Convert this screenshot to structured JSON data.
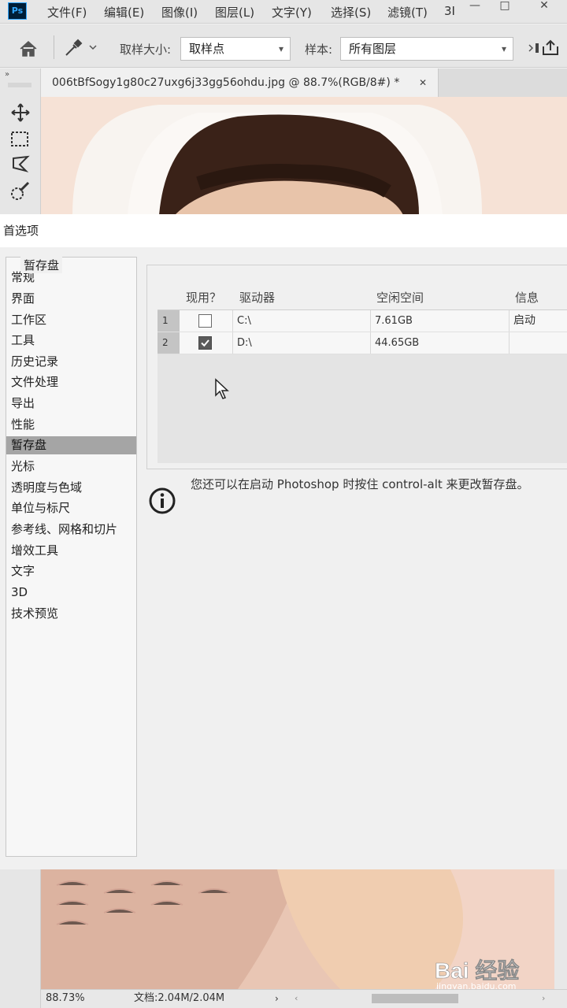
{
  "app": {
    "logo": "Ps"
  },
  "menu": [
    "文件(F)",
    "编辑(E)",
    "图像(I)",
    "图层(L)",
    "文字(Y)",
    "选择(S)",
    "滤镜(T)",
    "3I"
  ],
  "window_controls": [
    "—",
    "□",
    "✕"
  ],
  "options_bar": {
    "sample_size_label": "取样大小:",
    "sample_size_value": "取样点",
    "sample_label": "样本:",
    "sample_value": "所有图层"
  },
  "document_tab": {
    "title": "006tBfSogy1g80c27uxg6j33gg56ohdu.jpg @ 88.7%(RGB/8#) *",
    "close": "✕"
  },
  "dialog": {
    "title": "首选项",
    "categories": [
      "常规",
      "界面",
      "工作区",
      "工具",
      "历史记录",
      "文件处理",
      "导出",
      "性能",
      "暂存盘",
      "光标",
      "透明度与色域",
      "单位与标尺",
      "参考线、网格和切片",
      "增效工具",
      "文字",
      "3D",
      "技术预览"
    ],
    "selected_category": "暂存盘",
    "scratch_disks": {
      "group_title": "暂存盘",
      "columns": [
        "现用？",
        "驱动器",
        "空闲空间",
        "信息"
      ],
      "rows": [
        {
          "num": "1",
          "active": false,
          "drive": "C:\\",
          "free": "7.61GB",
          "info": "启动"
        },
        {
          "num": "2",
          "active": true,
          "drive": "D:\\",
          "free": "44.65GB",
          "info": ""
        }
      ]
    },
    "info_message": "您还可以在启动 Photoshop 时按住 control-alt 来更改暂存盘。"
  },
  "status_bar": {
    "zoom": "88.73%",
    "doc_size": "文档:2.04M/2.04M"
  },
  "watermark": {
    "brand": "Bai 经验",
    "url": "jingyan.baidu.com"
  },
  "colors": {
    "ps_logo_bg": "#001e36",
    "ps_logo_fg": "#31a8ff",
    "selected_category": "#a5a5a5"
  }
}
